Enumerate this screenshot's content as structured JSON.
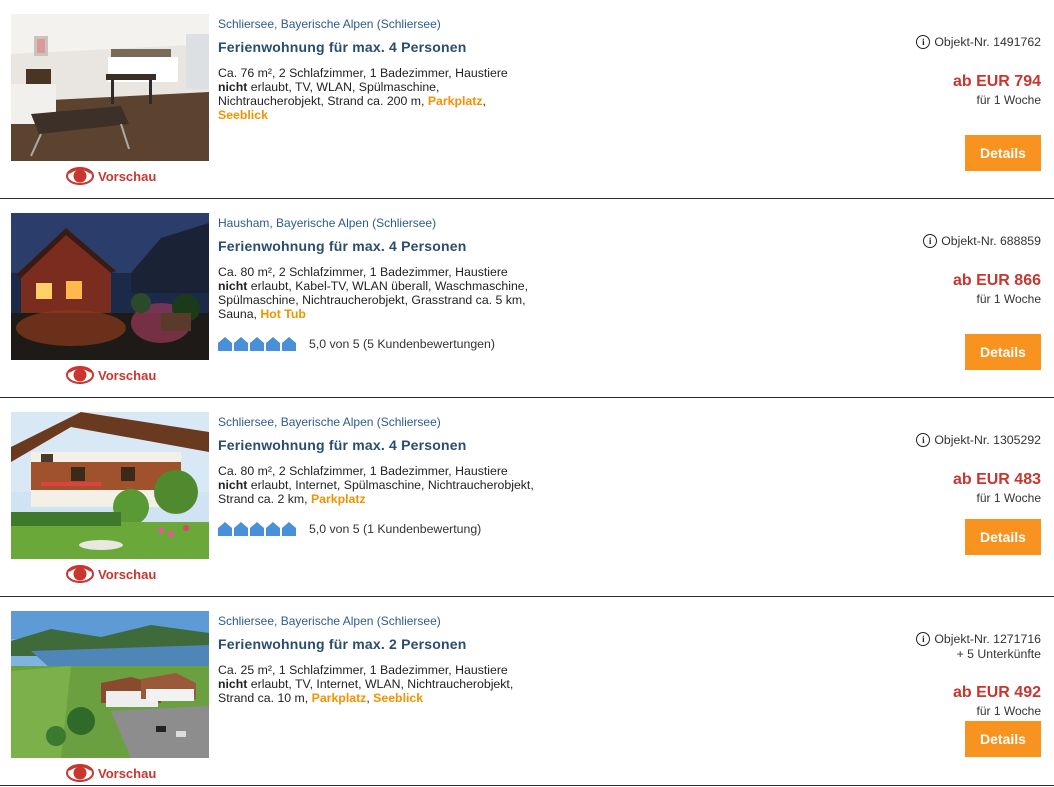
{
  "colors": {
    "link_blue": "#2c5d8a",
    "price_red": "#c8362f",
    "highlight_orange": "#f39200",
    "button_orange": "#f7931e",
    "rating_blue": "#4a90d9"
  },
  "listings": [
    {
      "location": "Schliersee, Bayerische Alpen (Schliersee)",
      "title": "Ferienwohnung für max. 4 Personen",
      "features": {
        "pre": "Ca. 76 m², 2 Schlafzimmer, 1 Badezimmer, Haustiere ",
        "neg": "nicht",
        "mid": " erlaubt, TV, WLAN, Spülmaschine, Nichtraucherobjekt, Strand ca. 200 m, ",
        "hl1": "Parkplatz",
        "sep": ", ",
        "hl2": "Seeblick"
      },
      "object_nr": "Objekt-Nr. 1491762",
      "price": "ab EUR 794",
      "period": "für 1 Woche",
      "details": "Details",
      "preview": "Vorschau",
      "image": "apartment-interior"
    },
    {
      "location": "Hausham, Bayerische Alpen (Schliersee)",
      "title": "Ferienwohnung für max. 4 Personen",
      "features": {
        "pre": "Ca. 80 m², 2 Schlafzimmer, 1 Badezimmer, Haustiere ",
        "neg": "nicht",
        "mid": " erlaubt, Kabel-TV, WLAN überall, Waschmaschine, Spülmaschine, Nichtraucherobjekt, Grasstrand ca. 5 km, Sauna, ",
        "hl1": "Hot Tub"
      },
      "rating": {
        "value": 5,
        "text": "5,0 von 5 (5 Kundenbewertungen)"
      },
      "object_nr": "Objekt-Nr. 688859",
      "price": "ab EUR 866",
      "period": "für 1 Woche",
      "details": "Details",
      "preview": "Vorschau",
      "image": "cabin-night"
    },
    {
      "location": "Schliersee, Bayerische Alpen (Schliersee)",
      "title": "Ferienwohnung für max. 4 Personen",
      "features": {
        "pre": "Ca. 80 m², 2 Schlafzimmer, 1 Badezimmer, Haustiere ",
        "neg": "nicht",
        "mid": " erlaubt, Internet, Spülmaschine, Nichtraucherobjekt, Strand ca. 2 km, ",
        "hl1": "Parkplatz"
      },
      "rating": {
        "value": 5,
        "text": "5,0 von 5 (1 Kundenbewertung)"
      },
      "object_nr": "Objekt-Nr. 1305292",
      "price": "ab EUR 483",
      "period": "für 1 Woche",
      "details": "Details",
      "preview": "Vorschau",
      "image": "chalet-garden"
    },
    {
      "location": "Schliersee, Bayerische Alpen (Schliersee)",
      "title": "Ferienwohnung für max. 2 Personen",
      "features": {
        "pre": "Ca. 25 m², 1 Schlafzimmer, 1 Badezimmer, Haustiere ",
        "neg": "nicht",
        "mid": " erlaubt, TV, Internet, WLAN, Nichtraucherobjekt, Strand ca. 10 m, ",
        "hl1": "Parkplatz",
        "sep": ", ",
        "hl2": "Seeblick"
      },
      "object_nr": "Objekt-Nr. 1271716",
      "extra": "+ 5 Unterkünfte",
      "price": "ab EUR 492",
      "period": "für 1 Woche",
      "details": "Details",
      "preview": "Vorschau",
      "image": "lake-aerial"
    }
  ]
}
